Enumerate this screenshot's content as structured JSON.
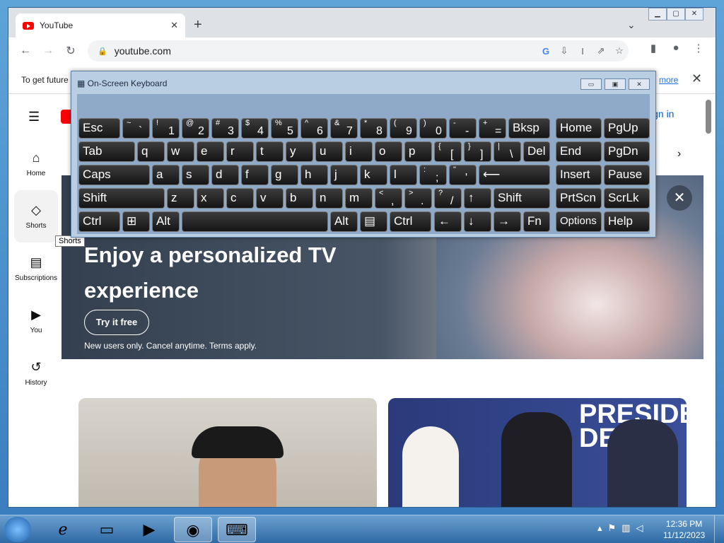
{
  "browser": {
    "tab_title": "YouTube",
    "tab_close": "✕",
    "new_tab": "+",
    "tab_menu": "⌄",
    "url": "youtube.com",
    "window_controls": [
      "▁",
      "▢",
      "✕"
    ],
    "toolbar_icons": [
      "G",
      "⇩",
      "I",
      "⇗",
      "☆"
    ],
    "right_icons": [
      "▮",
      "●",
      "⋮"
    ]
  },
  "infobar": {
    "text": "To get future",
    "link": "more",
    "close": "✕"
  },
  "youtube": {
    "sign_in": "ign in",
    "nav": [
      {
        "label": "Home",
        "icon": "⌂"
      },
      {
        "label": "Shorts",
        "icon": "◇"
      },
      {
        "label": "Subscriptions",
        "icon": "▤"
      },
      {
        "label": "You",
        "icon": "▶"
      },
      {
        "label": "History",
        "icon": "↺"
      }
    ],
    "tooltip": "Shorts",
    "banner": {
      "headline": "Enjoy a personalized TV experience",
      "button": "Try it free",
      "terms": "New users only. Cancel anytime. Terms apply.",
      "close": "✕"
    },
    "thumb2_text": "PRESIDENT DEBAT"
  },
  "osk": {
    "title": "On-Screen Keyboard",
    "controls": [
      "▭",
      "▣",
      "✕"
    ]
  },
  "taskbar": {
    "time": "12:36 PM",
    "date": "11/12/2023"
  }
}
